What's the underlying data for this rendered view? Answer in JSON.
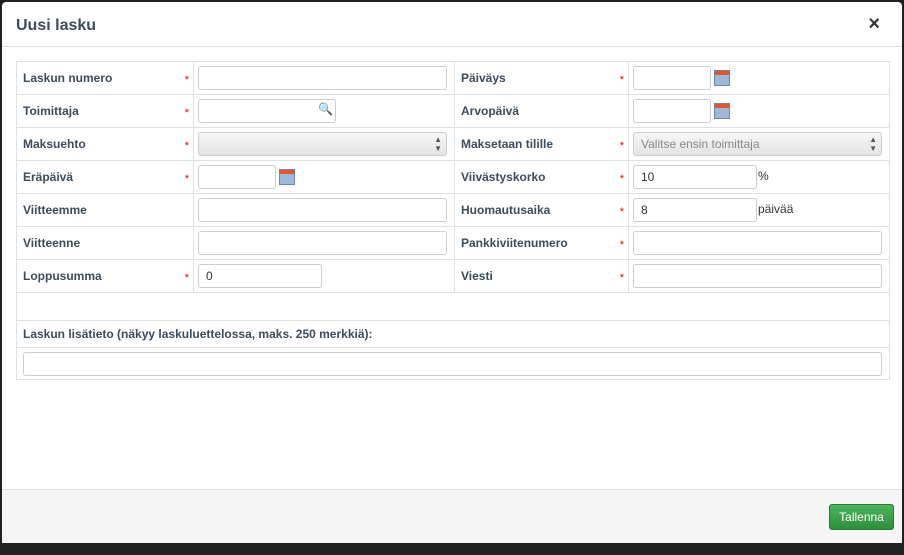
{
  "dialog": {
    "title": "Uusi lasku",
    "close_icon": "×"
  },
  "form": {
    "laskun_numero": {
      "label": "Laskun numero",
      "value": ""
    },
    "toimittaja": {
      "label": "Toimittaja",
      "value": ""
    },
    "maksuehto": {
      "label": "Maksuehto",
      "value": ""
    },
    "erapaiva": {
      "label": "Eräpäivä",
      "value": ""
    },
    "viitteemme": {
      "label": "Viitteemme",
      "value": ""
    },
    "viitteenne": {
      "label": "Viitteenne",
      "value": ""
    },
    "loppusumma": {
      "label": "Loppusumma",
      "value": "0"
    },
    "paivays": {
      "label": "Päiväys",
      "value": ""
    },
    "arvopaiva": {
      "label": "Arvopäivä",
      "value": ""
    },
    "maksetaan_tilille": {
      "label": "Maksetaan tilille",
      "value": "Valitse ensin toimittaja"
    },
    "viivastyskorko": {
      "label": "Viivästyskorko",
      "value": "10",
      "unit": "%"
    },
    "huomautusaika": {
      "label": "Huomautusaika",
      "value": "8",
      "unit": "päivää"
    },
    "pankkiviitenumero": {
      "label": "Pankkiviitenumero",
      "value": ""
    },
    "viesti": {
      "label": "Viesti",
      "value": ""
    },
    "lisatieto": {
      "label": "Laskun lisätieto (näkyy laskuluettelossa, maks. 250 merkkiä):",
      "value": ""
    },
    "required_mark": "*"
  },
  "footer": {
    "save_label": "Tallenna"
  }
}
